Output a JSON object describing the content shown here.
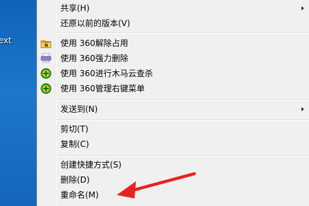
{
  "desktop": {
    "label": "ext"
  },
  "menu": {
    "items": [
      {
        "label": "共享(H)",
        "submenu": true
      },
      {
        "label": "还原以前的版本(V)"
      },
      {
        "label": "使用 360解除占用",
        "icon": "unlock-folder-icon"
      },
      {
        "label": "使用 360强力删除",
        "icon": "shredder-icon"
      },
      {
        "label": "使用 360进行木马云查杀",
        "icon": "360-shield-icon"
      },
      {
        "label": "使用 360管理右键菜单",
        "icon": "360-shield-icon"
      },
      {
        "label": "发送到(N)",
        "submenu": true
      },
      {
        "label": "剪切(T)"
      },
      {
        "label": "复制(C)"
      },
      {
        "label": "创建快捷方式(S)"
      },
      {
        "label": "删除(D)"
      },
      {
        "label": "重命名(M)"
      }
    ]
  },
  "annotation": {
    "arrow_color": "#e8231e",
    "target": "重命名(M)"
  },
  "colors": {
    "menu_bg": "#f0f0f0",
    "desktop_blue": "#1e77cc"
  }
}
